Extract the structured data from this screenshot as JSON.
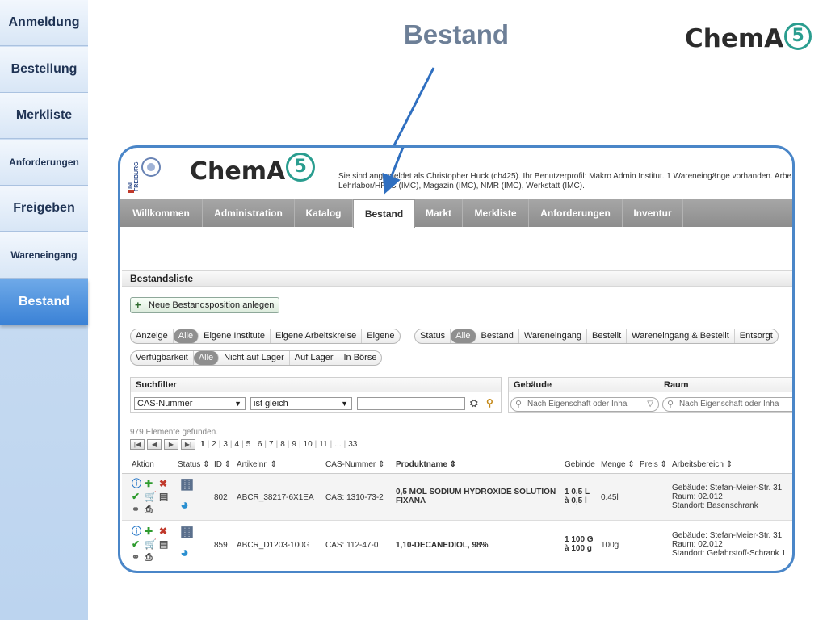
{
  "sidebar": {
    "items": [
      {
        "label": "Anmeldung",
        "active": false,
        "size": "normal"
      },
      {
        "label": "Bestellung",
        "active": false,
        "size": "normal"
      },
      {
        "label": "Merkliste",
        "active": false,
        "size": "normal"
      },
      {
        "label": "Anforderungen",
        "active": false,
        "size": "small"
      },
      {
        "label": "Freigeben",
        "active": false,
        "size": "normal"
      },
      {
        "label": "Wareneingang",
        "active": false,
        "size": "small"
      },
      {
        "label": "Bestand",
        "active": true,
        "size": "normal"
      }
    ]
  },
  "slide": {
    "title": "Bestand",
    "logo_text": "ChemA",
    "logo_number": "5"
  },
  "app": {
    "uni_seal_text": "UNI FREIBURG",
    "logo_text": "ChemA",
    "logo_number": "5",
    "login_line1": "Sie sind angemeldet als Christopher Huck (ch425). Ihr Benutzerprofil: Makro Admin Institut. 1 Wareneingänge vorhanden. Arbe",
    "login_line2": "Lehrlabor/HPLC (IMC), Magazin (IMC), NMR (IMC), Werkstatt (IMC).",
    "nav_tabs": [
      {
        "label": "Willkommen",
        "active": false
      },
      {
        "label": "Administration",
        "active": false
      },
      {
        "label": "Katalog",
        "active": false
      },
      {
        "label": "Bestand",
        "active": true
      },
      {
        "label": "Markt",
        "active": false
      },
      {
        "label": "Merkliste",
        "active": false
      },
      {
        "label": "Anforderungen",
        "active": false
      },
      {
        "label": "Inventur",
        "active": false
      }
    ],
    "section_title": "Bestandsliste",
    "add_button": "Neue Bestandsposition anlegen",
    "filter_anzeige": {
      "label": "Anzeige",
      "options": [
        "Alle",
        "Eigene Institute",
        "Eigene Arbeitskreise",
        "Eigene"
      ],
      "selected": "Alle"
    },
    "filter_status": {
      "label": "Status",
      "options": [
        "Alle",
        "Bestand",
        "Wareneingang",
        "Bestellt",
        "Wareneingang & Bestellt",
        "Entsorgt"
      ],
      "selected": "Alle"
    },
    "filter_verfuegbarkeit": {
      "label": "Verfügbarkeit",
      "options": [
        "Alle",
        "Nicht auf Lager",
        "Auf Lager",
        "In Börse"
      ],
      "selected": "Alle"
    },
    "suchfilter": {
      "title": "Suchfilter",
      "field": "CAS-Nummer",
      "operator": "ist gleich",
      "value": ""
    },
    "gebaeude": {
      "title": "Gebäude",
      "placeholder": "Nach Eigenschaft oder Inha"
    },
    "raum": {
      "title": "Raum",
      "placeholder": "Nach Eigenschaft oder Inha"
    },
    "found_text": "979 Elemente gefunden.",
    "pagination": {
      "pages": [
        "1",
        "2",
        "3",
        "4",
        "5",
        "6",
        "7",
        "8",
        "9",
        "10",
        "11",
        "...",
        "33"
      ],
      "current": "1"
    },
    "columns": [
      {
        "label": "Aktion",
        "sortable": false,
        "bold": false
      },
      {
        "label": "Status",
        "sortable": true,
        "bold": false
      },
      {
        "label": "ID",
        "sortable": true,
        "bold": false
      },
      {
        "label": "Artikelnr.",
        "sortable": true,
        "bold": false
      },
      {
        "label": "CAS-Nummer",
        "sortable": true,
        "bold": false
      },
      {
        "label": "Produktname",
        "sortable": true,
        "bold": true
      },
      {
        "label": "Gebinde",
        "sortable": false,
        "bold": false
      },
      {
        "label": "Menge",
        "sortable": true,
        "bold": false
      },
      {
        "label": "Preis",
        "sortable": true,
        "bold": false
      },
      {
        "label": "Arbeitsbereich",
        "sortable": true,
        "bold": false
      }
    ],
    "rows": [
      {
        "id": "802",
        "artikelnr": "ABCR_38217-6X1EA",
        "cas": "CAS: 1310-73-2",
        "produkt_line1": "0,5 MOL SODIUM HYDROXIDE SOLUTION",
        "produkt_line2": "FIXANA",
        "gebinde_line1": "1 0,5 L",
        "gebinde_line2": "à 0,5 l",
        "menge": "0.45l",
        "bereich_line1": "Gebäude: Stefan-Meier-Str. 31",
        "bereich_line2": "Raum: 02.012",
        "bereich_line3": "Standort: Basenschrank"
      },
      {
        "id": "859",
        "artikelnr": "ABCR_D1203-100G",
        "cas": "CAS: 112-47-0",
        "produkt_line1": "1,10-DECANEDIOL, 98%",
        "produkt_line2": "",
        "gebinde_line1": "1 100 G",
        "gebinde_line2": "à 100 g",
        "menge": "100g",
        "bereich_line1": "Gebäude: Stefan-Meier-Str. 31",
        "bereich_line2": "Raum: 02.012",
        "bereich_line3": "Standort: Gefahrstoff-Schrank 1"
      }
    ]
  },
  "colors": {
    "accent_blue": "#4a86c8",
    "title_gray": "#6d7f97",
    "logo_teal": "#2a9d8f",
    "nav_gray": "#999999"
  }
}
